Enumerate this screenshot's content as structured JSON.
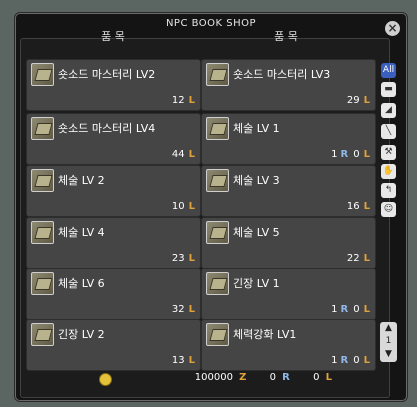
{
  "window": {
    "title": "NPC BOOK SHOP"
  },
  "columns": {
    "left": "품 목",
    "right": "품 목"
  },
  "items": [
    {
      "name": "숏소드 마스터리 LV2",
      "price": "12",
      "cost": "L",
      "rune": ""
    },
    {
      "name": "숏소드 마스터리 LV3",
      "price": "29",
      "cost": "L",
      "rune": ""
    },
    {
      "name": "숏소드 마스터리 LV4",
      "price": "44",
      "cost": "L",
      "rune": ""
    },
    {
      "name": "체술 LV 1",
      "price": "0",
      "cost": "L",
      "rune": "1"
    },
    {
      "name": "체술 LV 2",
      "price": "10",
      "cost": "L",
      "rune": ""
    },
    {
      "name": "체술 LV 3",
      "price": "16",
      "cost": "L",
      "rune": ""
    },
    {
      "name": "체술 LV 4",
      "price": "23",
      "cost": "L",
      "rune": ""
    },
    {
      "name": "체술 LV 5",
      "price": "22",
      "cost": "L",
      "rune": ""
    },
    {
      "name": "체술 LV 6",
      "price": "32",
      "cost": "L",
      "rune": ""
    },
    {
      "name": "긴장 LV 1",
      "price": "0",
      "cost": "L",
      "rune": "1"
    },
    {
      "name": "긴장 LV 2",
      "price": "13",
      "cost": "L",
      "rune": ""
    },
    {
      "name": "체력강화 LV1",
      "price": "0",
      "cost": "L",
      "rune": "1"
    }
  ],
  "tabs": [
    {
      "label": "All",
      "icon": "all-icon"
    },
    {
      "label": "▬",
      "icon": "book-icon"
    },
    {
      "label": "◢",
      "icon": "shoe-icon"
    },
    {
      "label": "╲",
      "icon": "dagger-icon"
    },
    {
      "label": "⚒",
      "icon": "hammer-icon"
    },
    {
      "label": "✋",
      "icon": "glove-icon"
    },
    {
      "label": "↰",
      "icon": "hook-icon"
    },
    {
      "label": "☺",
      "icon": "face-icon"
    }
  ],
  "pager": {
    "up": "▲",
    "page": "1",
    "down": "▼"
  },
  "footer": {
    "money": "100000",
    "money_unit": "Z",
    "rune": "0",
    "rune_unit": "R",
    "lv": "0",
    "lv_unit": "L"
  }
}
